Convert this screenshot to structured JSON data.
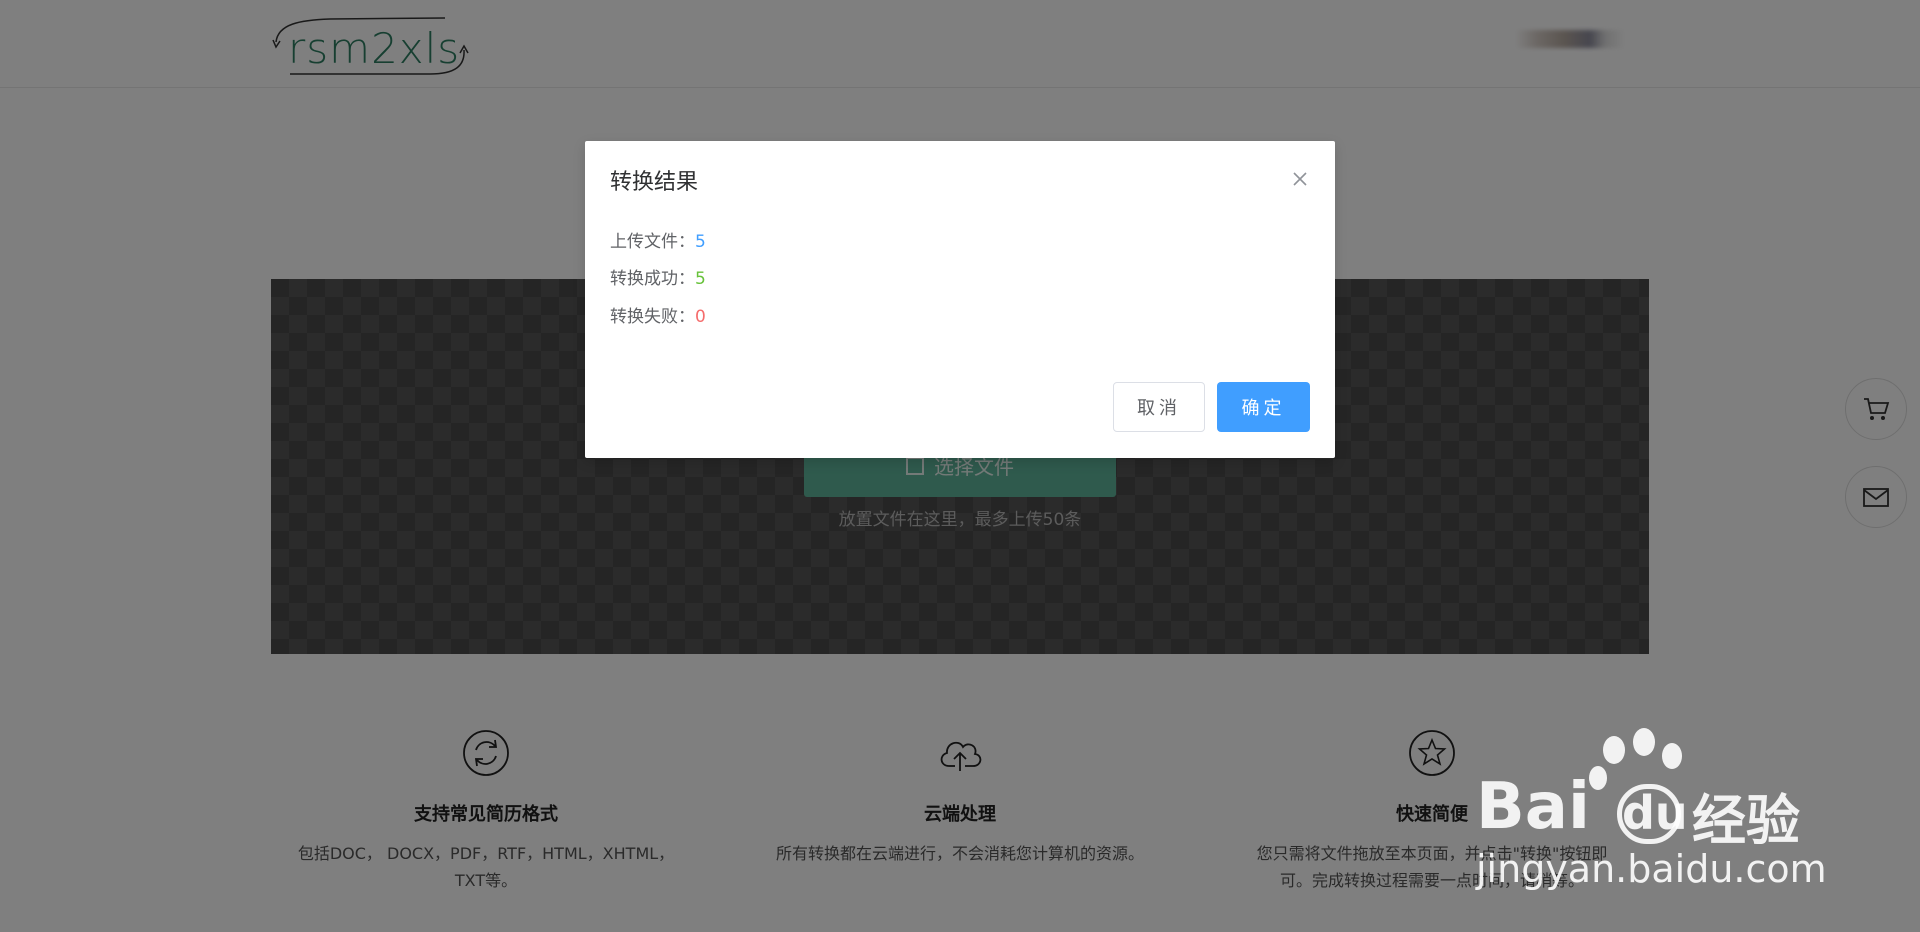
{
  "header": {
    "logo_text": "rsm2xls"
  },
  "upload": {
    "select_button_label": "选择文件",
    "hint": "放置文件在这里，最多上传50条"
  },
  "features": [
    {
      "title": "支持常见简历格式",
      "desc": "包括DOC， DOCX，PDF，RTF，HTML，XHTML，TXT等。",
      "icon": "refresh-icon"
    },
    {
      "title": "云端处理",
      "desc": "所有转换都在云端进行，不会消耗您计算机的资源。",
      "icon": "cloud-upload-icon"
    },
    {
      "title": "快速简便",
      "desc": "您只需将文件拖放至本页面，并点击\"转换\"按钮即可。完成转换过程需要一点时间，请稍等。",
      "icon": "star-icon"
    }
  ],
  "side_buttons": [
    "cart-icon",
    "mail-icon"
  ],
  "modal": {
    "title": "转换结果",
    "stats": [
      {
        "label": "上传文件：",
        "value": "5",
        "color": "#409eff"
      },
      {
        "label": "转换成功：",
        "value": "5",
        "color": "#67c23a"
      },
      {
        "label": "转换失败：",
        "value": "0",
        "color": "#f56c6c"
      }
    ],
    "cancel_label": "取消",
    "ok_label": "确定"
  },
  "watermark": {
    "brand": "Bai",
    "brand_du": "du",
    "brand_cn": "经验",
    "url": "jingyan.baidu.com"
  },
  "colors": {
    "accent": "#409eff",
    "brand_green": "#2e7f63",
    "upload_button": "#5fb49a"
  }
}
